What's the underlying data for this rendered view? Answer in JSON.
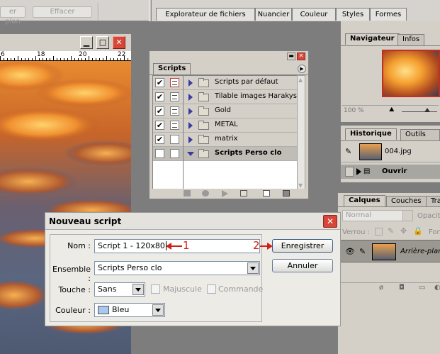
{
  "options_bar": {
    "save_label": "er plan",
    "clear_label": "Effacer"
  },
  "palette_well": {
    "tabs": [
      "Explorateur de fichiers",
      "Nuancier",
      "Couleur",
      "Styles",
      "Formes"
    ]
  },
  "document": {
    "ruler_numbers": [
      "6",
      "18",
      "20",
      "22"
    ]
  },
  "scripts_panel": {
    "tab": "Scripts",
    "items": [
      {
        "label": "Scripts par défaut",
        "checked": true,
        "dialog": "red",
        "expanded": false,
        "selected": false
      },
      {
        "label": "Tilable images Harakys",
        "checked": true,
        "dialog": "on",
        "expanded": false,
        "selected": false
      },
      {
        "label": "Gold",
        "checked": true,
        "dialog": "on",
        "expanded": false,
        "selected": false
      },
      {
        "label": "METAL",
        "checked": true,
        "dialog": "on",
        "expanded": false,
        "selected": false
      },
      {
        "label": "matrix",
        "checked": true,
        "dialog": "off",
        "expanded": false,
        "selected": false
      },
      {
        "label": "Scripts Perso clo",
        "checked": false,
        "dialog": "off",
        "expanded": true,
        "selected": true
      }
    ]
  },
  "navigator_panel": {
    "tabs": [
      "Navigateur",
      "Infos"
    ],
    "zoom": "100 %"
  },
  "history_panel": {
    "tabs": [
      "Historique",
      "Outils préd"
    ],
    "snapshot": "004.jpg",
    "state": "Ouvrir"
  },
  "layers_panel": {
    "tabs": [
      "Calques",
      "Couches",
      "Tra"
    ],
    "blend_mode": "Normal",
    "opacity_label": "Opacit",
    "lock_label": "Verrou :",
    "fill_label": "Fon",
    "layer_name": "Arrière-plan"
  },
  "dialog": {
    "title": "Nouveau script",
    "name_label": "Nom :",
    "name_value": "Script 1 - 120x80",
    "set_label": "Ensemble :",
    "set_value": "Scripts Perso clo",
    "key_label": "Touche :",
    "key_value": "Sans",
    "shift_label": "Majuscule",
    "ctrl_label": "Commande",
    "color_label": "Couleur :",
    "color_value": "Bleu",
    "color_swatch": "#a8c8f0",
    "record_label": "Enregistrer",
    "cancel_label": "Annuler",
    "annotation_1": "1",
    "annotation_2": "2"
  }
}
